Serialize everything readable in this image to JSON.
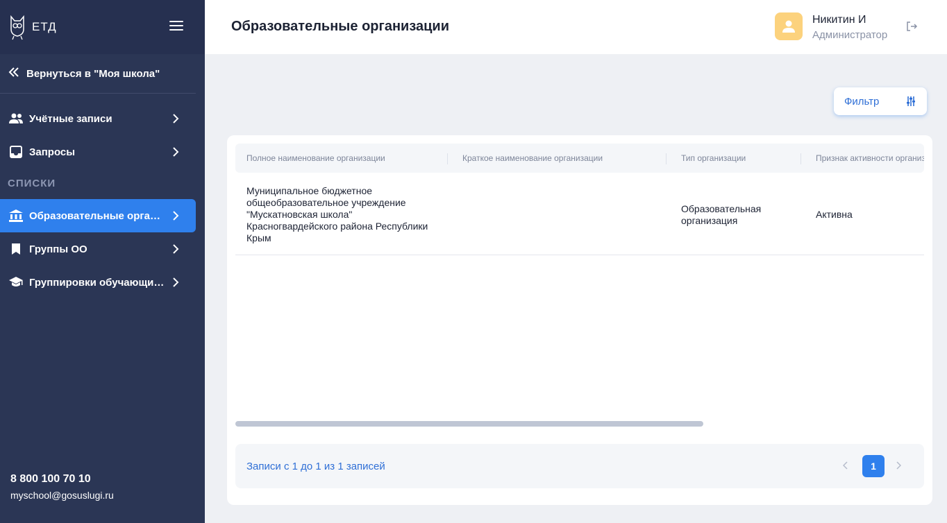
{
  "sidebar": {
    "logo_text": "ЕТД",
    "back_label": "Вернуться в \"Моя школа\"",
    "items": [
      {
        "label": "Учётные записи"
      },
      {
        "label": "Запросы"
      }
    ],
    "section_title": "СПИСКИ",
    "list_items": [
      {
        "label": "Образовательные организации"
      },
      {
        "label": "Группы ОО"
      },
      {
        "label": "Группировки обучающихся"
      }
    ],
    "phone": "8 800 100 70 10",
    "email": "myschool@gosuslugi.ru"
  },
  "header": {
    "title": "Образовательные организации",
    "user_name": "Никитин И",
    "user_role": "Администратор"
  },
  "filter": {
    "label": "Фильтр"
  },
  "table": {
    "columns": [
      "Полное наименование организации",
      "Краткое наименование организации",
      "Тип организации",
      "Признак активности организации"
    ],
    "rows": [
      {
        "full_name_lines": [
          "Муниципальное бюджетное",
          "общеобразовательное учреждение",
          "\"Мускатновская школа\"",
          "Красногвардейского района Республики",
          "Крым"
        ],
        "short_name": "",
        "type_lines": [
          "Образовательная",
          "организация"
        ],
        "active": "Активна"
      }
    ]
  },
  "pagination": {
    "info": "Записи с 1 до 1 из 1 записей",
    "current_page": "1"
  },
  "colors": {
    "sidebar_bg": "#2b3655",
    "accent": "#2f80ed",
    "avatar": "#fcd27d"
  }
}
